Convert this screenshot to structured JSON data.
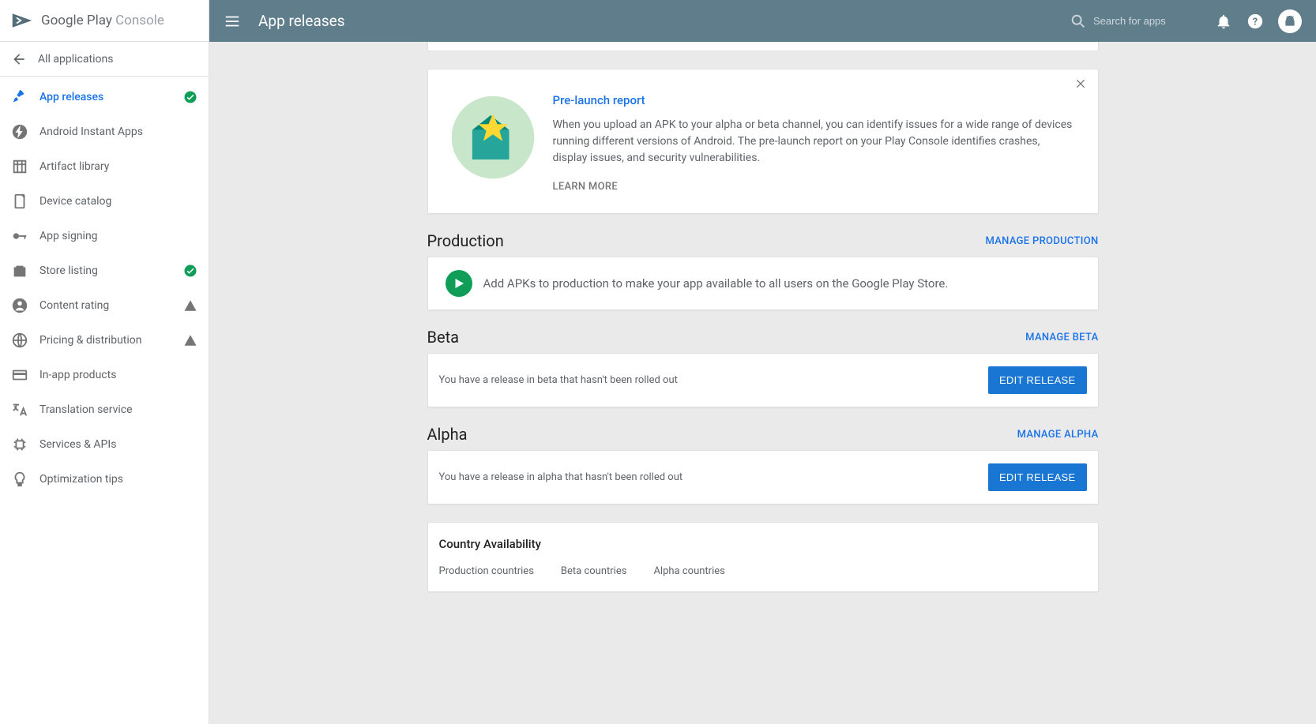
{
  "logo": {
    "main": "Google Play ",
    "sub": "Console"
  },
  "back_label": "All applications",
  "page_title": "App releases",
  "search_placeholder": "Search for apps",
  "sidebar": {
    "items": [
      {
        "label": "App releases"
      },
      {
        "label": "Android Instant Apps"
      },
      {
        "label": "Artifact library"
      },
      {
        "label": "Device catalog"
      },
      {
        "label": "App signing"
      },
      {
        "label": "Store listing"
      },
      {
        "label": "Content rating"
      },
      {
        "label": "Pricing & distribution"
      },
      {
        "label": "In-app products"
      },
      {
        "label": "Translation service"
      },
      {
        "label": "Services & APIs"
      },
      {
        "label": "Optimization tips"
      }
    ]
  },
  "prelaunch": {
    "title": "Pre-launch report",
    "body": "When you upload an APK to your alpha or beta channel, you can identify issues for a wide range of devices running different versions of Android. The pre-launch report on your Play Console identifies crashes, display issues, and security vulnerabilities.",
    "learn_more": "LEARN MORE"
  },
  "production": {
    "heading": "Production",
    "manage": "MANAGE PRODUCTION",
    "message": "Add APKs to production to make your app available to all users on the Google Play Store."
  },
  "beta": {
    "heading": "Beta",
    "manage": "MANAGE BETA",
    "message": "You have a release in beta that hasn't been rolled out",
    "button": "EDIT RELEASE"
  },
  "alpha": {
    "heading": "Alpha",
    "manage": "MANAGE ALPHA",
    "message": "You have a release in alpha that hasn't been rolled out",
    "button": "EDIT RELEASE"
  },
  "country": {
    "heading": "Country Availability",
    "tabs": [
      "Production countries",
      "Beta countries",
      "Alpha countries"
    ]
  }
}
